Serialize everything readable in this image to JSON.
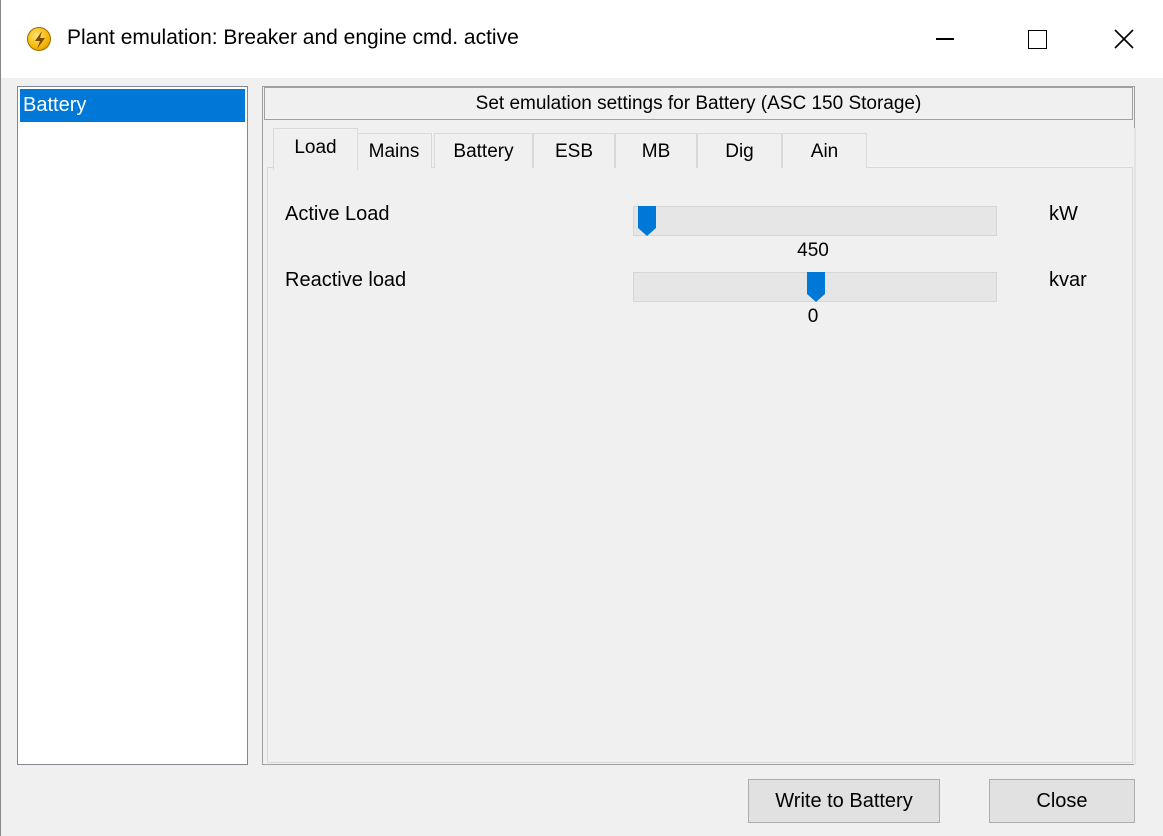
{
  "window": {
    "title": "Plant emulation: Breaker and engine cmd. active",
    "app_icon": "lightning-icon",
    "controls": {
      "minimize_icon": "minimize-icon",
      "maximize_icon": "maximize-icon",
      "close_icon": "close-icon"
    }
  },
  "left_list": {
    "items": [
      {
        "label": "Battery",
        "selected": true
      }
    ]
  },
  "panel": {
    "header": "Set emulation settings for Battery (ASC 150 Storage)",
    "tabs": [
      {
        "label": "Load",
        "active": true
      },
      {
        "label": "Mains"
      },
      {
        "label": "Battery"
      },
      {
        "label": "ESB"
      },
      {
        "label": "MB"
      },
      {
        "label": "Dig"
      },
      {
        "label": "Ain"
      }
    ],
    "load": {
      "active_load": {
        "label": "Active Load",
        "value": "450",
        "unit": "kW",
        "slider_fraction": 0.03
      },
      "reactive_load": {
        "label": "Reactive load",
        "value": "0",
        "unit": "kvar",
        "slider_fraction": 0.5
      }
    }
  },
  "buttons": {
    "write": "Write to Battery",
    "close": "Close"
  },
  "colors": {
    "selection": "#0078d7",
    "thumb": "#0078d7",
    "background": "#f0f0f0"
  }
}
